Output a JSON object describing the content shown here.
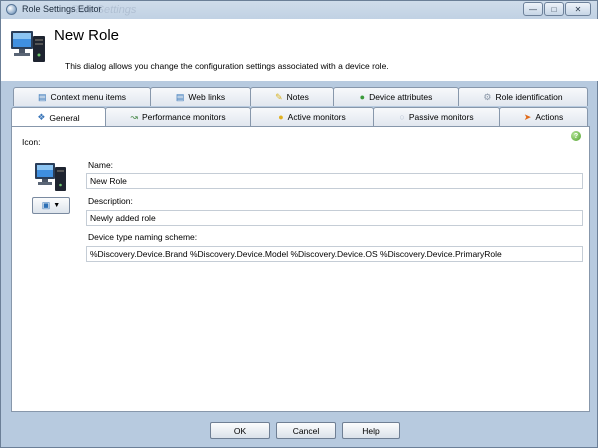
{
  "window": {
    "title": "Role Settings Editor",
    "ghost_title": "Role Settings"
  },
  "header": {
    "title": "New Role",
    "description": "This dialog allows you change the configuration settings associated with a device role."
  },
  "tabs_row1": [
    {
      "label": "Context menu items",
      "icon": "menu-icon"
    },
    {
      "label": "Web links",
      "icon": "web-icon"
    },
    {
      "label": "Notes",
      "icon": "note-icon"
    },
    {
      "label": "Device attributes",
      "icon": "attributes-icon"
    },
    {
      "label": "Role identification",
      "icon": "gear-icon"
    }
  ],
  "tabs_row2": [
    {
      "label": "General",
      "icon": "general-icon",
      "active": true
    },
    {
      "label": "Performance monitors",
      "icon": "chart-icon"
    },
    {
      "label": "Active monitors",
      "icon": "bulb-icon"
    },
    {
      "label": "Passive monitors",
      "icon": "passive-icon"
    },
    {
      "label": "Actions",
      "icon": "actions-icon"
    }
  ],
  "general": {
    "icon_label": "Icon:",
    "name_label": "Name:",
    "name_value": "New Role",
    "description_label": "Description:",
    "description_value": "Newly added role",
    "naming_label": "Device type naming scheme:",
    "naming_value": "%Discovery.Device.Brand %Discovery.Device.Model %Discovery.Device.OS %Discovery.Device.PrimaryRole"
  },
  "buttons": {
    "ok": "OK",
    "cancel": "Cancel",
    "help": "Help"
  },
  "colors": {
    "frame": "#b7cadf",
    "panel": "#ffffff",
    "tab_border": "#8797ab"
  }
}
